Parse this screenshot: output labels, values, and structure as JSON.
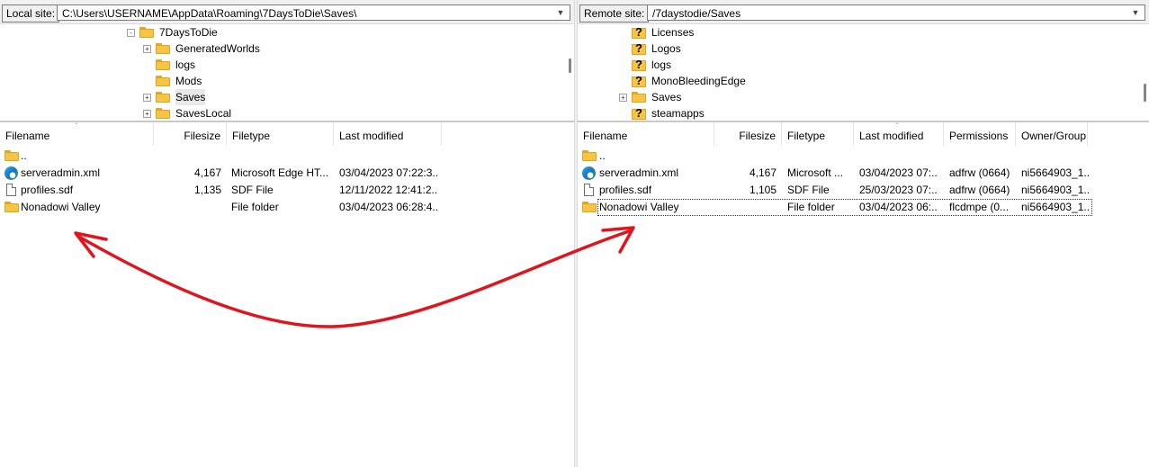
{
  "local": {
    "site_label": "Local site:",
    "path": "C:\\Users\\USERNAME\\AppData\\Roaming\\7DaysToDie\\Saves\\",
    "tree": [
      {
        "label": "7DaysToDie",
        "expander": "-",
        "icon": "folder-icon"
      },
      {
        "label": "GeneratedWorlds",
        "expander": "+",
        "icon": "folder-icon"
      },
      {
        "label": "logs",
        "expander": "",
        "icon": "folder-icon"
      },
      {
        "label": "Mods",
        "expander": "",
        "icon": "folder-icon"
      },
      {
        "label": "Saves",
        "expander": "+",
        "icon": "folder-icon",
        "selected": true
      },
      {
        "label": "SavesLocal",
        "expander": "+",
        "icon": "folder-icon"
      }
    ],
    "columns": [
      "Filename",
      "Filesize",
      "Filetype",
      "Last modified"
    ],
    "files": [
      {
        "name": "..",
        "size": "",
        "type": "",
        "modified": "",
        "icon": "folder-icon"
      },
      {
        "name": "serveradmin.xml",
        "size": "4,167",
        "type": "Microsoft Edge HT...",
        "modified": "03/04/2023 07:22:3...",
        "icon": "edge-icon"
      },
      {
        "name": "profiles.sdf",
        "size": "1,135",
        "type": "SDF File",
        "modified": "12/11/2022 12:41:2...",
        "icon": "document-icon"
      },
      {
        "name": "Nonadowi Valley",
        "size": "",
        "type": "File folder",
        "modified": "03/04/2023 06:28:4...",
        "icon": "folder-icon"
      }
    ]
  },
  "remote": {
    "site_label": "Remote site:",
    "path": "/7daystodie/Saves",
    "tree": [
      {
        "label": "Licenses",
        "expander": "",
        "icon": "unknown-folder-icon"
      },
      {
        "label": "Logos",
        "expander": "",
        "icon": "unknown-folder-icon"
      },
      {
        "label": "logs",
        "expander": "",
        "icon": "unknown-folder-icon"
      },
      {
        "label": "MonoBleedingEdge",
        "expander": "",
        "icon": "unknown-folder-icon"
      },
      {
        "label": "Saves",
        "expander": "+",
        "icon": "folder-icon"
      },
      {
        "label": "steamapps",
        "expander": "",
        "icon": "unknown-folder-icon"
      }
    ],
    "columns": [
      "Filename",
      "Filesize",
      "Filetype",
      "Last modified",
      "Permissions",
      "Owner/Group"
    ],
    "files": [
      {
        "name": "..",
        "size": "",
        "type": "",
        "modified": "",
        "permissions": "",
        "owner": "",
        "icon": "folder-icon"
      },
      {
        "name": "serveradmin.xml",
        "size": "4,167",
        "type": "Microsoft ...",
        "modified": "03/04/2023 07:...",
        "permissions": "adfrw (0664)",
        "owner": "ni5664903_1...",
        "icon": "edge-icon"
      },
      {
        "name": "profiles.sdf",
        "size": "1,105",
        "type": "SDF File",
        "modified": "25/03/2023 07:...",
        "permissions": "adfrw (0664)",
        "owner": "ni5664903_1...",
        "icon": "document-icon"
      },
      {
        "name": "Nonadowi Valley",
        "size": "",
        "type": "File folder",
        "modified": "03/04/2023 06:...",
        "permissions": "flcdmpe (0...",
        "owner": "ni5664903_1...",
        "icon": "folder-icon"
      }
    ]
  },
  "annotation": {
    "color": "#e0141c",
    "icon": "double-headed-arrow"
  }
}
